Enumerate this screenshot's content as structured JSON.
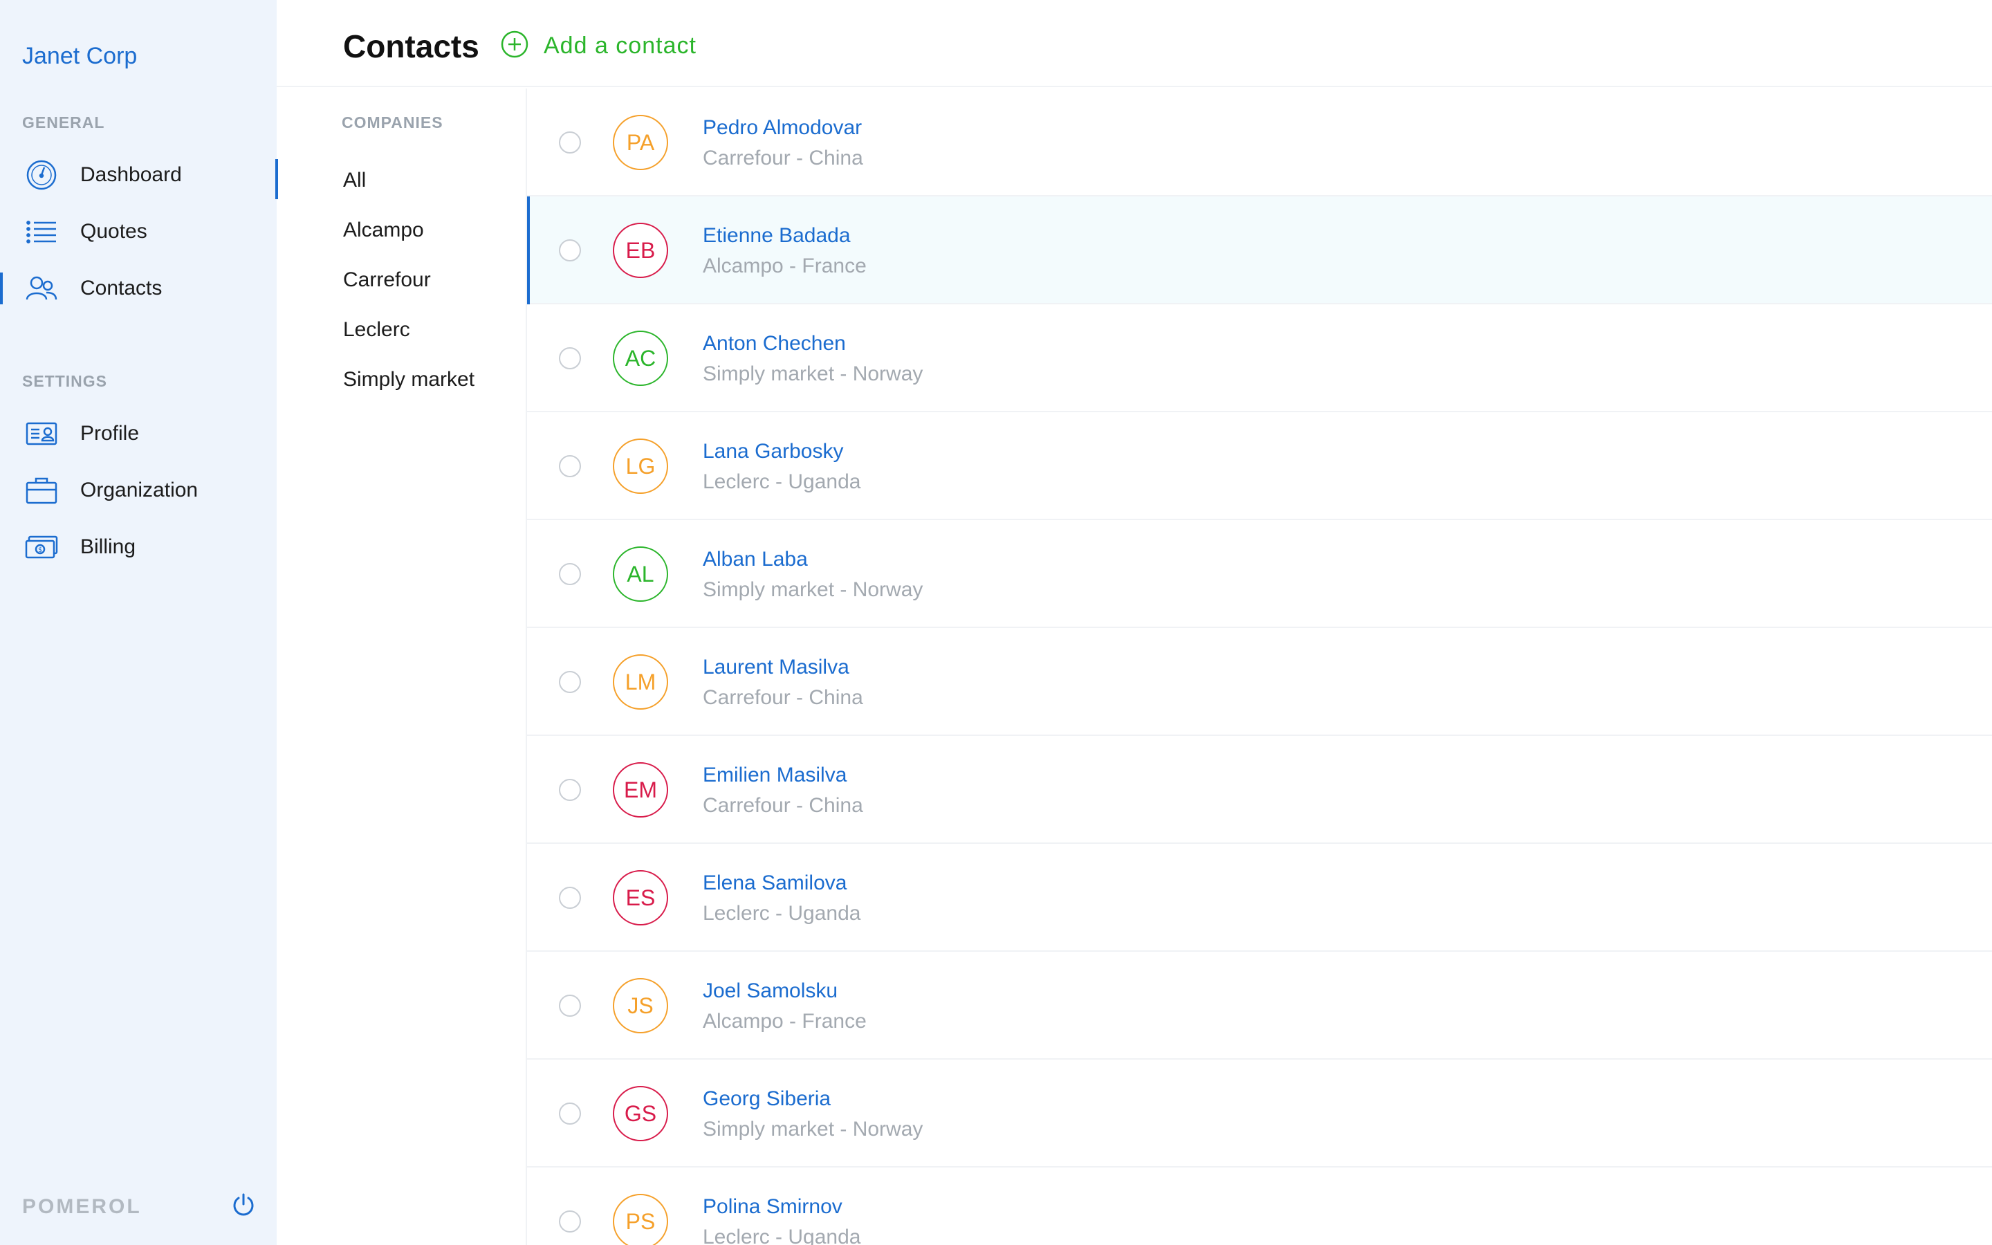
{
  "sidebar": {
    "brand": "Janet Corp",
    "general_label": "GENERAL",
    "settings_label": "SETTINGS",
    "general_items": [
      {
        "label": "Dashboard",
        "icon": "dashboard-icon"
      },
      {
        "label": "Quotes",
        "icon": "list-icon"
      },
      {
        "label": "Contacts",
        "icon": "users-icon"
      }
    ],
    "settings_items": [
      {
        "label": "Profile",
        "icon": "id-card-icon"
      },
      {
        "label": "Organization",
        "icon": "briefcase-icon"
      },
      {
        "label": "Billing",
        "icon": "money-icon"
      }
    ],
    "footer_brand": "POMEROL",
    "footer_icon": "power-icon"
  },
  "header": {
    "title": "Contacts",
    "add_label": "Add a contact"
  },
  "companies": {
    "label": "COMPANIES",
    "items": [
      "All",
      "Alcampo",
      "Carrefour",
      "Leclerc",
      "Simply market"
    ]
  },
  "colors": {
    "accent": "#1b6ccf",
    "green": "#2bb52b",
    "orange": "#f5a02a",
    "red": "#d81b4a"
  },
  "contacts": [
    {
      "initials": "PA",
      "name": "Pedro Almodovar",
      "sub": "Carrefour - China",
      "color": "#f5a02a"
    },
    {
      "initials": "EB",
      "name": "Etienne Badada",
      "sub": "Alcampo - France",
      "color": "#d81b4a"
    },
    {
      "initials": "AC",
      "name": "Anton Chechen",
      "sub": "Simply market - Norway",
      "color": "#2bb52b"
    },
    {
      "initials": "LG",
      "name": "Lana Garbosky",
      "sub": "Leclerc - Uganda",
      "color": "#f5a02a"
    },
    {
      "initials": "AL",
      "name": "Alban Laba",
      "sub": "Simply market - Norway",
      "color": "#2bb52b"
    },
    {
      "initials": "LM",
      "name": "Laurent Masilva",
      "sub": "Carrefour - China",
      "color": "#f5a02a"
    },
    {
      "initials": "EM",
      "name": "Emilien Masilva",
      "sub": "Carrefour - China",
      "color": "#d81b4a"
    },
    {
      "initials": "ES",
      "name": "Elena Samilova",
      "sub": "Leclerc - Uganda",
      "color": "#d81b4a"
    },
    {
      "initials": "JS",
      "name": "Joel Samolsku",
      "sub": "Alcampo - France",
      "color": "#f5a02a"
    },
    {
      "initials": "GS",
      "name": "Georg Siberia",
      "sub": "Simply market - Norway",
      "color": "#d81b4a"
    },
    {
      "initials": "PS",
      "name": "Polina Smirnov",
      "sub": "Leclerc - Uganda",
      "color": "#f5a02a"
    }
  ]
}
